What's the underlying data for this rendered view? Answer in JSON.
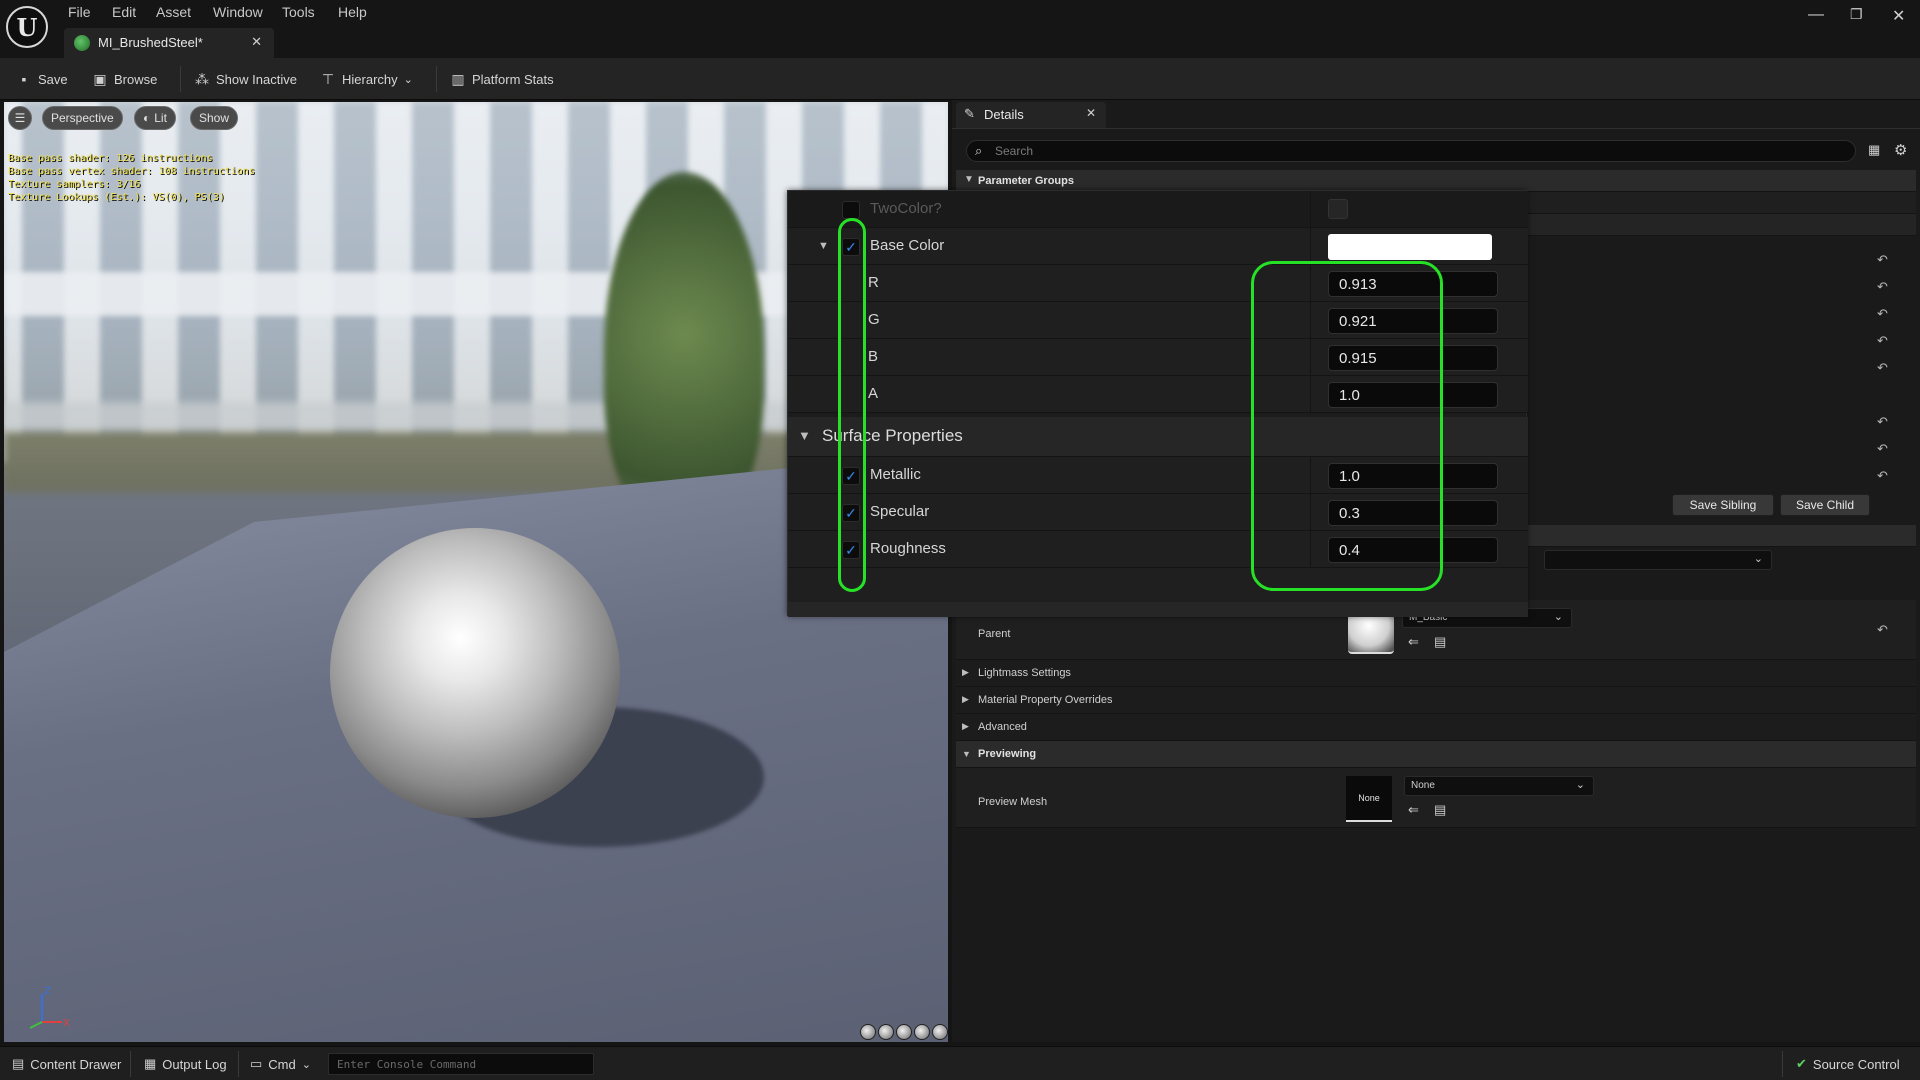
{
  "app": {
    "title_tab": "MI_BrushedSteel*"
  },
  "menu": [
    "File",
    "Edit",
    "Asset",
    "Window",
    "Tools",
    "Help"
  ],
  "toolbar": {
    "save": "Save",
    "browse": "Browse",
    "show_inactive": "Show Inactive",
    "hierarchy": "Hierarchy",
    "platform_stats": "Platform Stats"
  },
  "viewport": {
    "perspective": "Perspective",
    "lit": "Lit",
    "show": "Show",
    "stats": [
      "Base pass shader: 126 instructions",
      "Base pass vertex shader: 108 instructions",
      "Texture samplers: 3/16",
      "Texture Lookups (Est.): VS(0), PS(3)"
    ],
    "axis_labels": {
      "z": "Z",
      "x": "X"
    }
  },
  "details": {
    "tab": "Details",
    "search_placeholder": "Search",
    "parameter_groups": "Parameter Groups",
    "save_sibling": "Save Sibling",
    "save_child": "Save Child",
    "parent_label": "Parent",
    "parent_value": "M_Basic",
    "lightmass": "Lightmass Settings",
    "overrides": "Material Property Overrides",
    "advanced": "Advanced",
    "previewing": "Previewing",
    "preview_mesh_label": "Preview Mesh",
    "preview_mesh_thumb": "None",
    "preview_mesh_value": "None"
  },
  "zoom": {
    "two_color": "TwoColor?",
    "base_color": "Base Color",
    "base_color_swatch": "#ffffff",
    "channels": [
      {
        "label": "R",
        "value": "0.913"
      },
      {
        "label": "G",
        "value": "0.921"
      },
      {
        "label": "B",
        "value": "0.915"
      },
      {
        "label": "A",
        "value": "1.0"
      }
    ],
    "surface_properties": "Surface Properties",
    "surface": [
      {
        "label": "Metallic",
        "value": "1.0"
      },
      {
        "label": "Specular",
        "value": "0.3"
      },
      {
        "label": "Roughness",
        "value": "0.4"
      }
    ],
    "highlight_color": "#27e127"
  },
  "statusbar": {
    "content_drawer": "Content Drawer",
    "output_log": "Output Log",
    "cmd": "Cmd",
    "console_placeholder": "Enter Console Command",
    "source_control": "Source Control"
  }
}
